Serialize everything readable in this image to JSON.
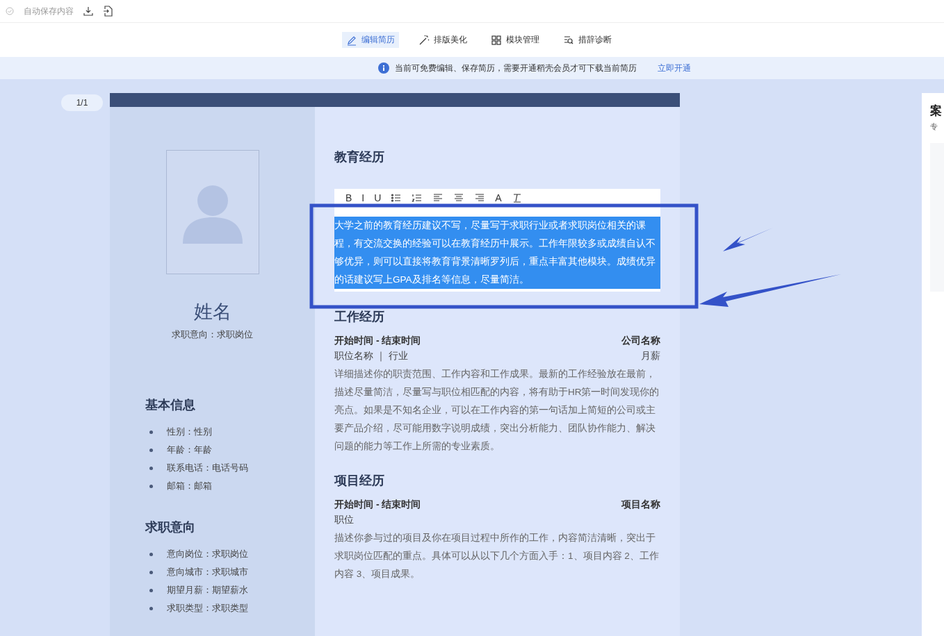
{
  "top_bar": {
    "autosave": "自动保存内容"
  },
  "nav_tabs": [
    {
      "label": "编辑简历",
      "kind": "edit",
      "selected": true
    },
    {
      "label": "排版美化",
      "kind": "wand",
      "selected": false
    },
    {
      "label": "模块管理",
      "kind": "grid",
      "selected": false
    },
    {
      "label": "措辞诊断",
      "kind": "diagnose",
      "selected": false
    }
  ],
  "notice": {
    "text": "当前可免费编辑、保存简历，需要开通稻壳会员才可下载当前简历",
    "link": "立即开通"
  },
  "page_counter": "1/1",
  "resume": {
    "name": "姓名",
    "intent": "求职意向：求职岗位",
    "sidebar_sections": [
      {
        "title": "基本信息",
        "items": [
          "性别：性别",
          "年龄：年龄",
          "联系电话：电话号码",
          "邮箱：邮箱"
        ]
      },
      {
        "title": "求职意向",
        "items": [
          "意向岗位：求职岗位",
          "意向城市：求职城市",
          "期望月薪：期望薪水",
          "求职类型：求职类型"
        ]
      }
    ],
    "education": {
      "title": "教育经历",
      "editor_buttons": [
        {
          "kind": "text",
          "label": "B"
        },
        {
          "kind": "text",
          "label": "I"
        },
        {
          "kind": "text",
          "label": "U"
        },
        {
          "kind": "bullets"
        },
        {
          "kind": "numbers"
        },
        {
          "kind": "align-left"
        },
        {
          "kind": "align-center"
        },
        {
          "kind": "align-right"
        },
        {
          "kind": "text",
          "label": "A"
        },
        {
          "kind": "clear"
        }
      ],
      "text": "大学之前的教育经历建议不写，尽量写于求职行业或者求职岗位相关的课程，有交流交换的经验可以在教育经历中展示。工作年限较多或成绩自认不够优异，则可以直接将教育背景清晰罗列后，重点丰富其他模块。成绩优异的话建议写上GPA及排名等信息，尽量简洁。",
      "selected": true
    },
    "entries": [
      {
        "title": "工作经历",
        "date_range": "开始时间 - 结束时间",
        "right_title": "公司名称",
        "subtitle": "职位名称 ｜ 行业",
        "right_subtitle": "月薪",
        "description": "详细描述你的职责范围、工作内容和工作成果。最新的工作经验放在最前，描述尽量简洁，尽量写与职位相匹配的内容，将有助于HR第一时间发现你的亮点。如果是不知名企业，可以在工作内容的第一句话加上简短的公司或主要产品介绍，尽可能用数字说明成绩，突出分析能力、团队协作能力、解决问题的能力等工作上所需的专业素质。"
      },
      {
        "title": "项目经历",
        "date_range": "开始时间 - 结束时间",
        "right_title": "项目名称",
        "subtitle": "职位",
        "description": "描述你参与过的项目及你在项目过程中所作的工作，内容简洁清晰，突出于求职岗位匹配的重点。具体可以从以下几个方面入手：1、项目内容 2、工作内容 3、项目成果。"
      }
    ]
  },
  "side_panel": {
    "title": "案",
    "subtitle": "专"
  }
}
